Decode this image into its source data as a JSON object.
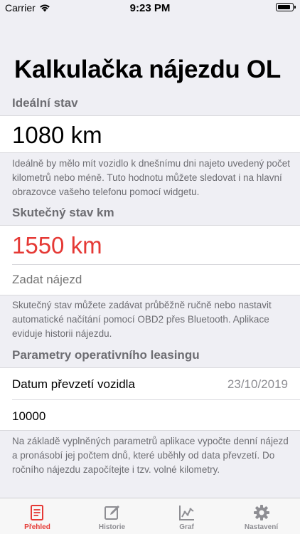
{
  "status_bar": {
    "carrier": "Carrier",
    "time": "9:23 PM"
  },
  "title": "Kalkulačka nájezdu OL",
  "ideal": {
    "header": "Ideální stav",
    "value": "1080 km",
    "footer": "Ideálně by mělo mít vozidlo k dnešnímu dni najeto uvedený počet kilometrů nebo méně. Tuto hodnotu můžete sledovat i na hlavní obrazovce vašeho telefonu pomocí widgetu."
  },
  "actual": {
    "header": "Skutečný stav km",
    "value": "1550 km",
    "value_color": "#e53935",
    "input_placeholder": "Zadat nájezd",
    "footer": "Skutečný stav můžete zadávat průběžně ručně nebo nastavit automatické načítání pomocí OBD2 přes Bluetooth. Aplikace eviduje historii nájezdu."
  },
  "params": {
    "header": "Parametry operativního leasingu",
    "date_label": "Datum převzetí vozidla",
    "date_value": "23/10/2019",
    "mileage_value": "10000",
    "footer": "Na základě vyplněných parametrů aplikace vypočte denní nájezd a pronásobí jej počtem dnů, které uběhly od data převzetí. Do ročního nájezdu započítejte i tzv. volné kilometry."
  },
  "tabs": [
    {
      "label": "Přehled",
      "icon": "overview-icon",
      "active": true
    },
    {
      "label": "Historie",
      "icon": "history-icon",
      "active": false
    },
    {
      "label": "Graf",
      "icon": "chart-icon",
      "active": false
    },
    {
      "label": "Nastavení",
      "icon": "gear-icon",
      "active": false
    }
  ],
  "colors": {
    "accent": "#e53935",
    "background": "#efeff4",
    "secondary_text": "#6d6d72"
  }
}
